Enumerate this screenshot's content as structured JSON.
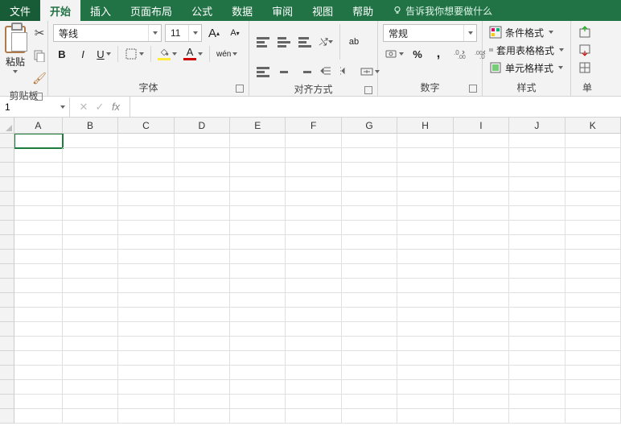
{
  "tabs": {
    "file": "文件​",
    "home": "开始",
    "insert": "插入",
    "layout": "页面布局",
    "formulas": "公式",
    "data": "数据",
    "review": "审阅",
    "view": "视图",
    "help": "帮助",
    "tellme": "告诉我你想要做什么"
  },
  "ribbon": {
    "clipboard": {
      "paste": "粘贴",
      "group_label": "剪贴板"
    },
    "font": {
      "name": "等线",
      "size": "11",
      "bold": "B",
      "italic": "I",
      "underline": "U",
      "phonetic": "wén",
      "group_label": "字体",
      "font_a_large": "A",
      "font_a_small": "A"
    },
    "alignment": {
      "wrap": "ab",
      "group_label": "对齐方式"
    },
    "number": {
      "format": "常规",
      "percent": "%",
      "comma": ",",
      "group_label": "数字"
    },
    "styles": {
      "cond": "条件格式",
      "table": "套用表格格式",
      "cell": "单元格样式",
      "group_label": "样式"
    },
    "cells": {
      "group_label": "单"
    }
  },
  "formula_bar": {
    "name_box": "1",
    "fx": "fx"
  },
  "grid": {
    "cols": [
      "A",
      "B",
      "C",
      "D",
      "E",
      "F",
      "G",
      "H",
      "I",
      "J",
      "K"
    ],
    "row_count": 20
  }
}
